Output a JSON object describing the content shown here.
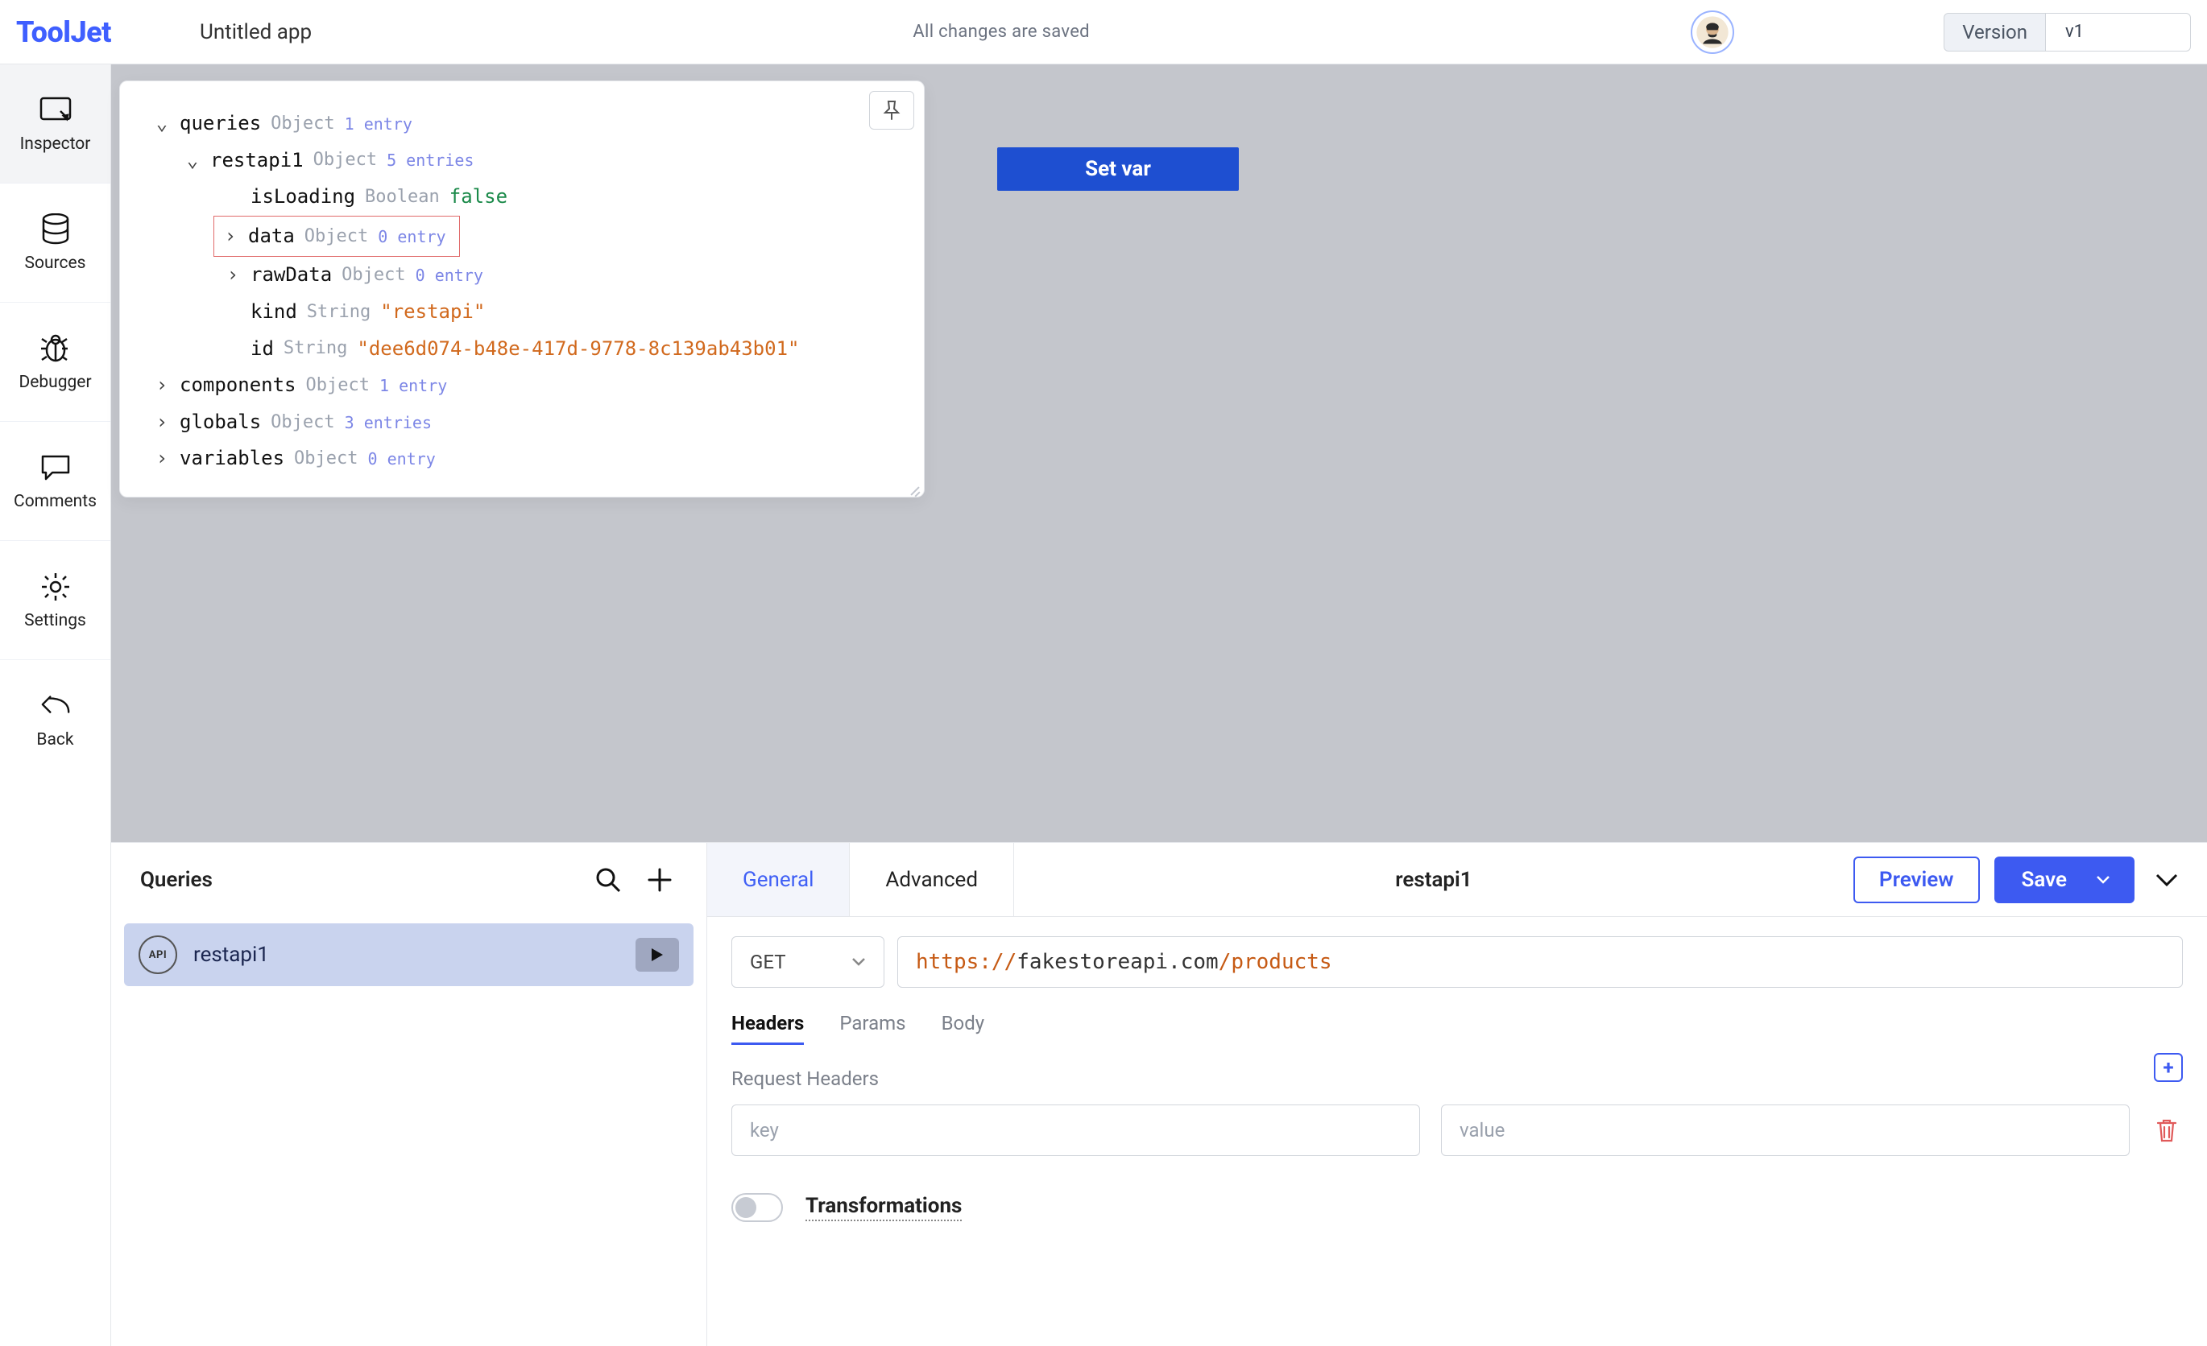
{
  "header": {
    "logo": "ToolJet",
    "app_name": "Untitled app",
    "save_status": "All changes are saved",
    "version_label": "Version",
    "version_value": "v1"
  },
  "left_nav": [
    {
      "key": "inspector",
      "label": "Inspector"
    },
    {
      "key": "sources",
      "label": "Sources"
    },
    {
      "key": "debugger",
      "label": "Debugger"
    },
    {
      "key": "comments",
      "label": "Comments"
    },
    {
      "key": "settings",
      "label": "Settings"
    },
    {
      "key": "back",
      "label": "Back"
    }
  ],
  "canvas": {
    "setvar_label": "Set var"
  },
  "inspector": {
    "queries": {
      "key": "queries",
      "type": "Object",
      "count": "1 entry"
    },
    "restapi": {
      "key": "restapi1",
      "type": "Object",
      "count": "5 entries"
    },
    "isLoading": {
      "key": "isLoading",
      "type": "Boolean",
      "value": "false"
    },
    "data": {
      "key": "data",
      "type": "Object",
      "count": "0 entry"
    },
    "rawData": {
      "key": "rawData",
      "type": "Object",
      "count": "0 entry"
    },
    "kind": {
      "key": "kind",
      "type": "String",
      "value": "\"restapi\""
    },
    "id": {
      "key": "id",
      "type": "String",
      "value": "\"dee6d074-b48e-417d-9778-8c139ab43b01\""
    },
    "components": {
      "key": "components",
      "type": "Object",
      "count": "1 entry"
    },
    "globals": {
      "key": "globals",
      "type": "Object",
      "count": "3 entries"
    },
    "variables": {
      "key": "variables",
      "type": "Object",
      "count": "0 entry"
    }
  },
  "queries_panel": {
    "title": "Queries",
    "items": [
      {
        "name": "restapi1",
        "icon_label": "API"
      }
    ]
  },
  "config": {
    "tabs": {
      "general": "General",
      "advanced": "Advanced"
    },
    "current_query_name": "restapi1",
    "actions": {
      "preview": "Preview",
      "save": "Save"
    },
    "method": "GET",
    "url": {
      "scheme": "https:",
      "sep": "//",
      "host": "fakestoreapi.com",
      "path": "/products"
    },
    "sub_tabs": {
      "headers": "Headers",
      "params": "Params",
      "body": "Body"
    },
    "section_request_headers": "Request Headers",
    "kv": {
      "key_placeholder": "key",
      "value_placeholder": "value"
    },
    "transformations_label": "Transformations"
  }
}
